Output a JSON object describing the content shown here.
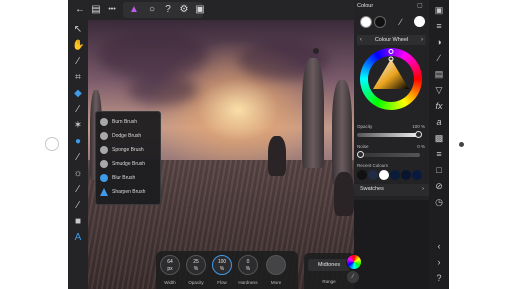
{
  "topbar": {
    "icons": [
      "back-icon",
      "document-icon",
      "more-icon",
      "affinity-persona-icon",
      "lasso-icon",
      "help-icon",
      "settings-icon",
      "layout-icon"
    ],
    "more_label": "•••"
  },
  "tools": [
    "move-icon",
    "hand-icon",
    "crop-icon",
    "selection-brush-icon",
    "flood-fill-icon",
    "brush-icon",
    "clone-icon",
    "retouch-icon",
    "smudge-icon",
    "dodge-icon",
    "colour-picker-icon",
    "shape-icon",
    "text-icon"
  ],
  "brush_popup": {
    "items": [
      {
        "label": "Burn Brush"
      },
      {
        "label": "Dodge Brush"
      },
      {
        "label": "Sponge Brush"
      },
      {
        "label": "Smudge Brush"
      },
      {
        "label": "Blur Brush"
      },
      {
        "label": "Sharpen Brush"
      }
    ]
  },
  "bottom_controls": {
    "dials": [
      {
        "label": "Width",
        "value": "64",
        "unit": "px"
      },
      {
        "label": "Opacity",
        "value": "25",
        "unit": "%"
      },
      {
        "label": "Flow",
        "value": "100",
        "unit": "%"
      },
      {
        "label": "Hardness",
        "value": "0",
        "unit": "%"
      },
      {
        "label": "More",
        "value": "",
        "unit": ""
      }
    ],
    "midtones": "Midtones",
    "range_label": "Range"
  },
  "colour_panel": {
    "title": "Colour",
    "mode": "Colour Wheel",
    "opacity_label": "Opacity",
    "opacity_value": "100 %",
    "noise_label": "Noise",
    "noise_value": "0 %",
    "recent_label": "Recent Colours",
    "recent_colours": [
      "#111111",
      "#1f2c44",
      "#ffffff",
      "#0b1b3a",
      "#091530",
      "#0a1a3f"
    ],
    "swatches_label": "Swatches"
  },
  "studio_icons": [
    "brush-studio-icon",
    "layers-icon",
    "adjustment-icon",
    "effects-icon",
    "channels-icon",
    "history-icon",
    "navigator-icon",
    "transform-icon",
    "fx-icon",
    "text-style-icon",
    "character-icon",
    "paragraph-icon",
    "colour-icon",
    "stock-icon",
    "navigation-left-icon",
    "navigation-right-icon",
    "help-icon"
  ],
  "colors": {
    "accent": "#3d9be9",
    "persona": "#c15bf0",
    "panel": "#232325"
  }
}
